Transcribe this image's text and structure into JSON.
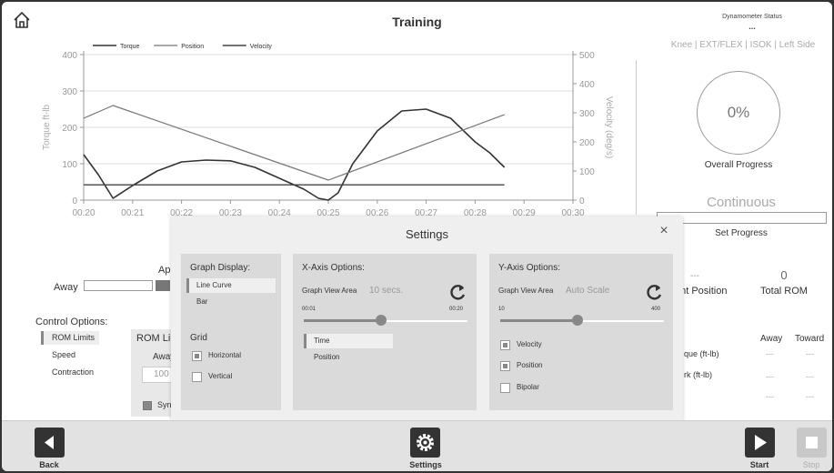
{
  "header": {
    "title": "Training",
    "dynamometer_status_label": "Dynamometer Status",
    "dynamometer_status_value": "...",
    "session_info": "Knee | EXT/FLEX | ISOK | Left Side"
  },
  "chart_data": {
    "type": "line",
    "legend": [
      "Torque",
      "Position",
      "Velocity"
    ],
    "legend_placement": "top",
    "ylabel_left": "Torque ft-lb",
    "ylabel_right": "Velocity (deg/s)",
    "y_left_ticks": [
      "400",
      "300",
      "200",
      "100",
      "0"
    ],
    "y_right_ticks": [
      "500",
      "400",
      "300",
      "200",
      "100",
      "0"
    ],
    "ylim_left": [
      0,
      400
    ],
    "ylim_right": [
      0,
      500
    ],
    "x_ticks": [
      "00:20",
      "00:21",
      "00:22",
      "00:23",
      "00:24",
      "00:25",
      "00:26",
      "00:27",
      "00:28",
      "00:29",
      "00:30"
    ],
    "series": [
      {
        "name": "Torque",
        "axis": "left",
        "x": [
          "00:20",
          "00:20.3",
          "00:20.6",
          "00:21",
          "00:21.5",
          "00:22",
          "00:22.5",
          "00:23",
          "00:23.5",
          "00:24",
          "00:24.5",
          "00:24.8",
          "00:25",
          "00:25.2",
          "00:25.5",
          "00:26",
          "00:26.5",
          "00:27",
          "00:27.5",
          "00:28",
          "00:28.3",
          "00:28.6"
        ],
        "values": [
          125,
          70,
          5,
          40,
          80,
          105,
          110,
          108,
          90,
          60,
          30,
          5,
          0,
          20,
          100,
          190,
          245,
          250,
          225,
          160,
          130,
          90
        ]
      },
      {
        "name": "Position",
        "axis": "left",
        "x": [
          "00:20",
          "00:20.6",
          "00:25",
          "00:28.6"
        ],
        "values": [
          225,
          260,
          55,
          235
        ]
      },
      {
        "name": "Velocity",
        "axis": "left",
        "x": [
          "00:20",
          "00:28.6"
        ],
        "values": [
          42,
          42
        ]
      }
    ],
    "grid": true
  },
  "progress": {
    "overall_value": "0%",
    "overall_fraction": 0,
    "overall_label": "Overall Progress",
    "mode": "Continuous",
    "set_progress_label": "Set Progress",
    "set_progress_fraction": 0
  },
  "left": {
    "away_label": "Away",
    "ap_label": "Ap",
    "control_options_label": "Control Options:",
    "control_options": [
      "ROM Limits",
      "Speed",
      "Contraction"
    ],
    "rom_limits_label": "ROM Li",
    "rom_away_label": "Away",
    "rom_away_value": "100",
    "sync_label": "Syn"
  },
  "stats": {
    "current_position_value": "---",
    "current_position_label": "ent Position",
    "total_rom_value": "0",
    "total_rom_label": "Total ROM",
    "table_headers": [
      "Away",
      "Toward"
    ],
    "rows": [
      {
        "label": "que (ft-lb)",
        "away": "---",
        "toward": "---"
      },
      {
        "label": "rk (ft-lb)",
        "away": "---",
        "toward": "---"
      },
      {
        "label": "",
        "away": "---",
        "toward": "---"
      }
    ]
  },
  "settings": {
    "title": "Settings",
    "graph_display": {
      "title": "Graph Display:",
      "options": [
        "Line Curve",
        "Bar"
      ],
      "selected": "Line Curve",
      "grid_title": "Grid",
      "grid_options": [
        {
          "label": "Horizontal",
          "checked": true
        },
        {
          "label": "Vertical",
          "checked": false
        }
      ]
    },
    "x_axis": {
      "title": "X-Axis Options:",
      "view_area_label": "Graph View Area",
      "view_area_value": "10 secs.",
      "slider_min": "00:01",
      "slider_max": "00:20",
      "slider_fraction": 0.47,
      "options": [
        "Time",
        "Position"
      ],
      "selected": "Time"
    },
    "y_axis": {
      "title": "Y-Axis Options:",
      "view_area_label": "Graph View Area",
      "view_area_value": "Auto Scale",
      "slider_min": "10",
      "slider_max": "400",
      "slider_fraction": 0.47,
      "options": [
        {
          "label": "Velocity",
          "checked": true
        },
        {
          "label": "Position",
          "checked": true
        },
        {
          "label": "Bipolar",
          "checked": false
        }
      ]
    }
  },
  "footer": {
    "back_label": "Back",
    "settings_label": "Settings",
    "start_label": "Start",
    "stop_label": "Stop"
  }
}
